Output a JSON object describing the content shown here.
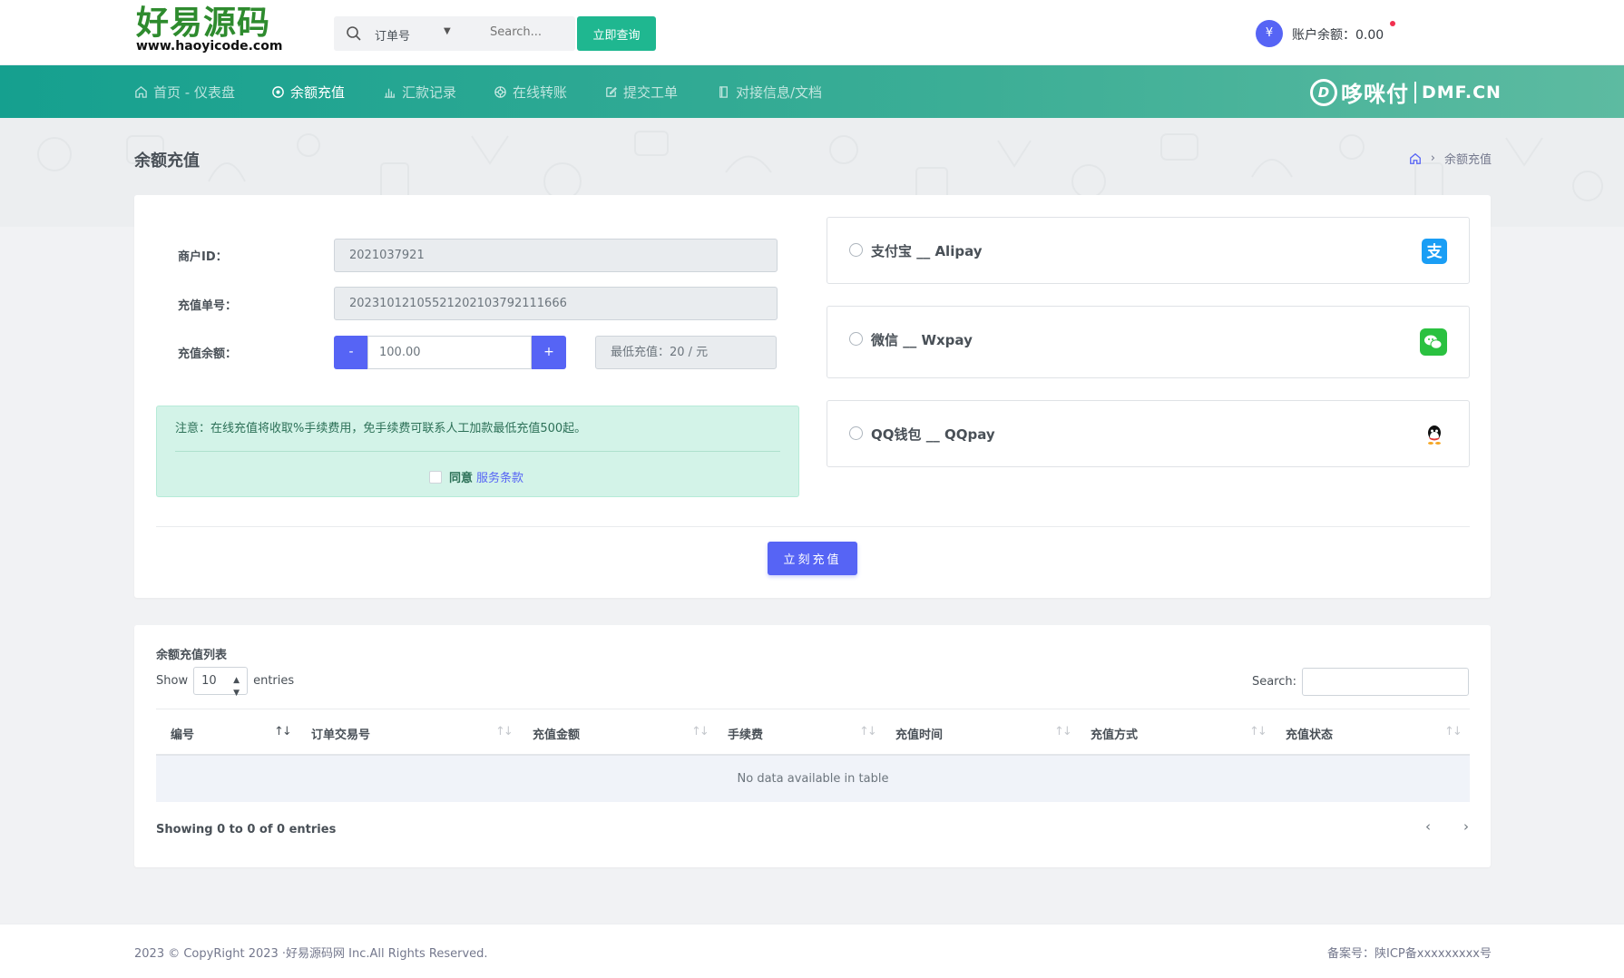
{
  "header": {
    "logo_title": "好易源码",
    "logo_subtitle": "www.haoyicode.com",
    "search_select": "订单号",
    "search_placeholder": "Search...",
    "query_button": "立即查询",
    "balance_symbol": "¥",
    "balance_text": "账户余额：0.00"
  },
  "nav": {
    "items": [
      {
        "label": "首页 - 仪表盘",
        "icon": "home-icon"
      },
      {
        "label": "余额充值",
        "icon": "target-icon"
      },
      {
        "label": "汇款记录",
        "icon": "bar-chart-icon"
      },
      {
        "label": "在线转账",
        "icon": "aperture-icon"
      },
      {
        "label": "提交工单",
        "icon": "edit-icon"
      },
      {
        "label": "对接信息/文档",
        "icon": "book-icon"
      }
    ],
    "active_index": 1,
    "brand_name": "哆咪付",
    "brand_domain": "DMF.CN"
  },
  "page": {
    "title": "余额充值",
    "breadcrumb_current": "余额充值"
  },
  "form": {
    "merchant_id_label": "商户ID：",
    "merchant_id_value": "2021037921",
    "order_no_label": "充值单号：",
    "order_no_value": "20231012105521202103792111666",
    "amount_label": "充值余额：",
    "minus_label": "-",
    "plus_label": "+",
    "amount_value": "100.00",
    "min_amount": "最低充值：20 / 元",
    "notice": "注意：在线充值将收取%手续费用，免手续费可联系人工加款最低充值500起。",
    "agree_label": "同意",
    "terms_link": "服务条款",
    "submit_label": "立刻充值"
  },
  "payment_methods": [
    {
      "label": "支付宝 __ Alipay",
      "icon": "alipay-icon",
      "color": "#1a9ef5"
    },
    {
      "label": "微信 __ Wxpay",
      "icon": "wechat-icon",
      "color": "#2ac140"
    },
    {
      "label": "QQ钱包 __ QQpay",
      "icon": "qq-icon",
      "color": "#111111"
    }
  ],
  "table": {
    "title": "余额充值列表",
    "show_label": "Show",
    "page_size": "10",
    "entries_label": "entries",
    "search_label": "Search:",
    "columns": [
      "编号",
      "订单交易号",
      "充值金额",
      "手续费",
      "充值时间",
      "充值方式",
      "充值状态"
    ],
    "empty_text": "No data available in table",
    "info": "Showing 0 to 0 of 0 entries",
    "prev": "‹",
    "next": "›"
  },
  "footer": {
    "copyright": "2023 © CopyRight 2023 ·好易源码网 Inc.All Rights Reserved.",
    "icp": "备案号：陕ICP备xxxxxxxxx号"
  },
  "colors": {
    "primary": "#5664f5",
    "teal": "#1fb790",
    "notice_bg": "#d3f3e8"
  }
}
